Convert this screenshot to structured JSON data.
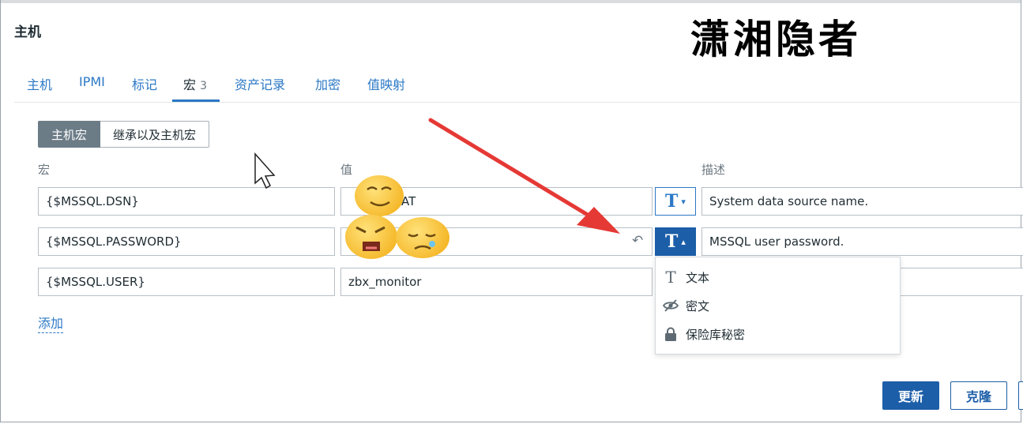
{
  "page": {
    "title": "主机"
  },
  "watermark": {
    "text": "潇湘隐者"
  },
  "tabs": [
    {
      "label": "主机"
    },
    {
      "label": "IPMI"
    },
    {
      "label": "标记"
    },
    {
      "label": "宏",
      "count": "3"
    },
    {
      "label": "资产记录"
    },
    {
      "label": "加密"
    },
    {
      "label": "值映射"
    }
  ],
  "segmented": {
    "host_macros": "主机宏",
    "inherited_macros": "继承以及主机宏"
  },
  "columns": {
    "macro": "宏",
    "value": "值",
    "description": "描述"
  },
  "rows": [
    {
      "macro": "{$MSSQL.DSN}",
      "value": "UAT",
      "description": "System data source name."
    },
    {
      "macro": "{$MSSQL.PASSWORD}",
      "value": "",
      "description": "MSSQL user password."
    },
    {
      "macro": "{$MSSQL.USER}",
      "value": "zbx_monitor",
      "description": ""
    }
  ],
  "add_link": "添加",
  "type_menu": [
    {
      "label": "文本",
      "icon": "text-icon"
    },
    {
      "label": "密文",
      "icon": "eye-slash-icon"
    },
    {
      "label": "保险库秘密",
      "icon": "lock-icon"
    }
  ],
  "type_button": {
    "glyph": "T"
  },
  "buttons": {
    "update": "更新",
    "clone": "克隆"
  },
  "colors": {
    "accent": "#2b78c5",
    "primary": "#1c5ea8",
    "arrow": "#e53935"
  }
}
